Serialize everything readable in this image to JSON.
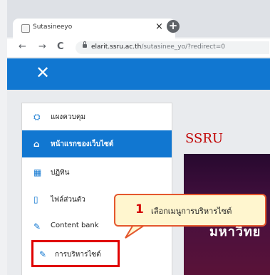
{
  "browser": {
    "tab_title": "Sutasineeyo",
    "close_glyph": "×",
    "new_tab_glyph": "+",
    "back_glyph": "←",
    "forward_glyph": "→",
    "reload_glyph": "C",
    "url_host": "elarit.ssru.ac.th",
    "url_path": "/sutasinee_yo/?redirect=0"
  },
  "header": {
    "close_glyph": "✕",
    "color": "#1177d1"
  },
  "sidebar": {
    "items": [
      {
        "label": "แผงควบคุม",
        "icon": "dashboard-icon",
        "glyph": "⛭"
      },
      {
        "label": "หน้าแรกของเว็บไซต์",
        "icon": "home-icon",
        "glyph": "⌂",
        "active": true
      },
      {
        "label": "ปฏิทิน",
        "icon": "calendar-icon",
        "glyph": "▦"
      },
      {
        "label": "ไฟล์ส่วนตัว",
        "icon": "file-icon",
        "glyph": "▯"
      },
      {
        "label": "Content bank",
        "icon": "paint-brush-icon",
        "glyph": "✎"
      },
      {
        "label": "การบริหารไซต์",
        "icon": "wrench-icon",
        "glyph": "✎"
      }
    ]
  },
  "main": {
    "site_title": "SSRU",
    "banner_text": "มหาวิทย"
  },
  "callout": {
    "number": "1",
    "text": "เลือกเมนูการบริหารไซต์",
    "border_color": "#e4572e",
    "highlight_color": "#e00000"
  }
}
